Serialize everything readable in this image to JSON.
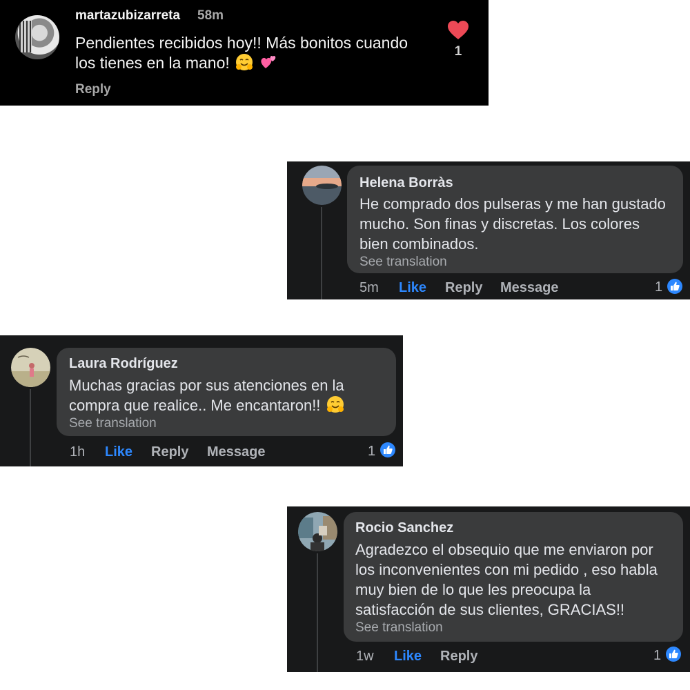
{
  "instagram_comment": {
    "username": "martazubizarreta",
    "time": "58m",
    "text": "Pendientes recibidos hoy!! Más bonitos cuando los tienes en la mano!",
    "emojis": [
      "hugging-face-icon",
      "two-hearts-icon"
    ],
    "reply_label": "Reply",
    "like_count": "1",
    "heart_color": "#ed4956"
  },
  "facebook_comments": [
    {
      "name": "Helena Borràs",
      "text": "He comprado dos pulseras y me han gustado mucho. Son finas y discretas. Los colores bien combinados.",
      "see_translation": "See translation",
      "time": "5m",
      "like_label": "Like",
      "reply_label": "Reply",
      "message_label": "Message",
      "reaction_count": "1"
    },
    {
      "name": "Laura Rodríguez",
      "text": "Muchas gracias por sus atenciones en la compra que realice.. Me encantaron!!",
      "emoji": "hugging-face-icon",
      "see_translation": "See translation",
      "time": "1h",
      "like_label": "Like",
      "reply_label": "Reply",
      "message_label": "Message",
      "reaction_count": "1"
    },
    {
      "name": "Rocio Sanchez",
      "text": "Agradezco el obsequio que me enviaron por los inconvenientes con mi pedido , eso habla muy bien de lo que les preocupa la satisfacción de sus clientes, GRACIAS!!",
      "see_translation": "See translation",
      "time": "1w",
      "like_label": "Like",
      "reply_label": "Reply",
      "reaction_count": "1"
    }
  ],
  "colors": {
    "facebook_like_blue": "#2d88ff",
    "facebook_bubble": "#3a3b3c",
    "facebook_background": "#18191a",
    "instagram_background": "#000000"
  }
}
